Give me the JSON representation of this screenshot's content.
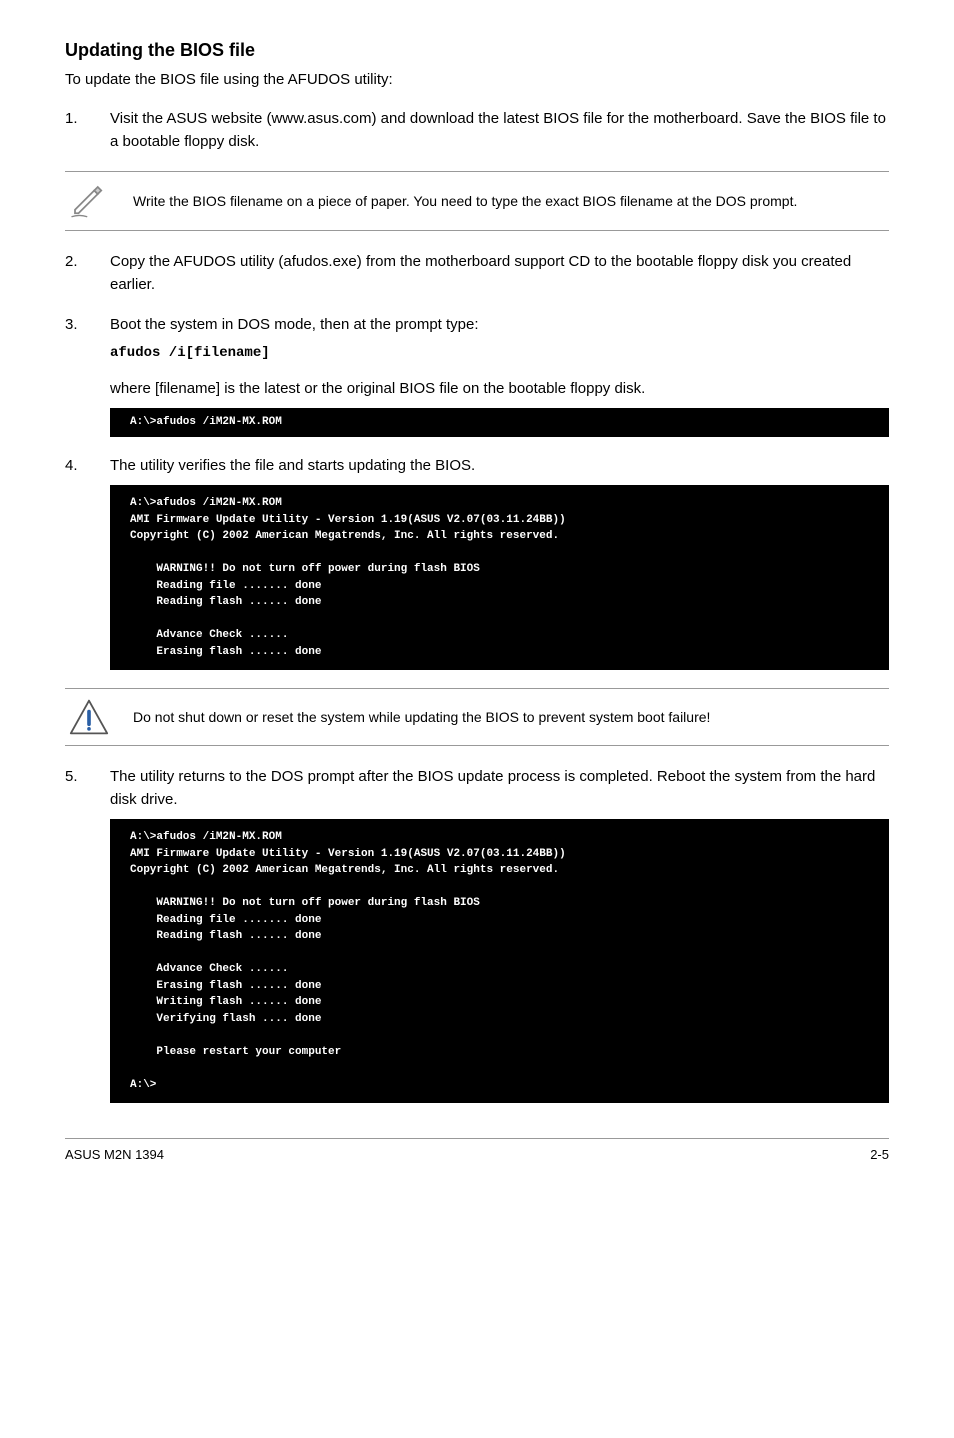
{
  "heading": "Updating the BIOS file",
  "intro": "To update the BIOS file using the AFUDOS utility:",
  "step1": {
    "num": "1.",
    "text": "Visit the ASUS website (www.asus.com) and download the latest BIOS file for the motherboard. Save the BIOS file to a bootable floppy disk."
  },
  "note1": "Write the BIOS filename on a piece of paper. You need to type the exact BIOS filename at the DOS prompt.",
  "step2": {
    "num": "2.",
    "text": "Copy the AFUDOS utility (afudos.exe) from the motherboard support CD to the bootable floppy disk you created earlier."
  },
  "step3": {
    "num": "3.",
    "text": "Boot the system in DOS mode, then at the prompt type:",
    "command": "afudos /i[filename]",
    "sub": "where [filename] is the latest or the original BIOS file on the bootable floppy disk."
  },
  "terminal1": "A:\\>afudos /iM2N-MX.ROM",
  "step4": {
    "num": "4.",
    "text": "The utility verifies the file and starts updating the BIOS."
  },
  "terminal2": "A:\\>afudos /iM2N-MX.ROM\nAMI Firmware Update Utility - Version 1.19(ASUS V2.07(03.11.24BB))\nCopyright (C) 2002 American Megatrends, Inc. All rights reserved.\n\n    WARNING!! Do not turn off power during flash BIOS\n    Reading file ....... done\n    Reading flash ...... done\n\n    Advance Check ......\n    Erasing flash ...... done",
  "note2": "Do not shut down or reset the system while updating the BIOS to prevent system boot failure!",
  "step5": {
    "num": "5.",
    "text": "The utility returns to the DOS prompt after the BIOS update process is completed. Reboot the system from the hard disk drive."
  },
  "terminal3": "A:\\>afudos /iM2N-MX.ROM\nAMI Firmware Update Utility - Version 1.19(ASUS V2.07(03.11.24BB))\nCopyright (C) 2002 American Megatrends, Inc. All rights reserved.\n\n    WARNING!! Do not turn off power during flash BIOS\n    Reading file ....... done\n    Reading flash ...... done\n\n    Advance Check ......\n    Erasing flash ...... done\n    Writing flash ...... done\n    Verifying flash .... done\n\n    Please restart your computer\n\nA:\\>",
  "footer": {
    "left": "ASUS M2N 1394",
    "right": "2-5"
  }
}
